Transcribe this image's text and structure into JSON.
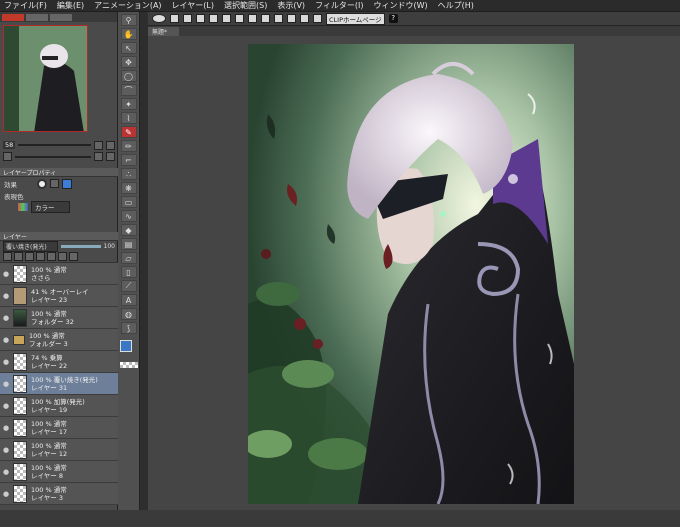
{
  "menu": [
    "ファイル(F)",
    "編集(E)",
    "アニメーション(A)",
    "レイヤー(L)",
    "選択範囲(S)",
    "表示(V)",
    "フィルター(I)",
    "ウィンドウ(W)",
    "ヘルプ(H)"
  ],
  "command_bar": {
    "clip_button": "CLIPホームページ",
    "help_icon": "?"
  },
  "document_tab": "無題*",
  "navigator": {
    "zoom": "58"
  },
  "layer_property": {
    "header": "レイヤープロパティ",
    "effect_label": "効果",
    "color_label": "表現色",
    "color_value": "カラー"
  },
  "layer_panel": {
    "header": "レイヤー",
    "blend_mode": "覆い焼き(発光)",
    "opacity": "100",
    "layers": [
      {
        "line1": "100 % 通常",
        "line2": "ささら",
        "thumb": "checker"
      },
      {
        "line1": "41 % オーバーレイ",
        "line2": "レイヤー 23",
        "thumb": "#b59a77"
      },
      {
        "line1": "100 % 通常",
        "line2": "フォルダー 32",
        "thumb": "art"
      },
      {
        "line1": "100 % 通常",
        "line2": "フォルダー 3",
        "thumb": "folder"
      },
      {
        "line1": "74 % 乗算",
        "line2": "レイヤー 22",
        "thumb": "checker"
      },
      {
        "line1": "100 % 覆い焼き(発光)",
        "line2": "レイヤー 31",
        "thumb": "checker"
      },
      {
        "line1": "100 % 加算(発光)",
        "line2": "レイヤー 19",
        "thumb": "checker"
      },
      {
        "line1": "100 % 通常",
        "line2": "レイヤー 17",
        "thumb": "checker"
      },
      {
        "line1": "100 % 通常",
        "line2": "レイヤー 12",
        "thumb": "checker"
      },
      {
        "line1": "100 % 通常",
        "line2": "レイヤー 8",
        "thumb": "checker"
      },
      {
        "line1": "100 % 通常",
        "line2": "レイヤー 3",
        "thumb": "checker"
      }
    ]
  },
  "colors": {
    "accent_red": "#c0392b",
    "selected_layer": "#6d7f99"
  }
}
